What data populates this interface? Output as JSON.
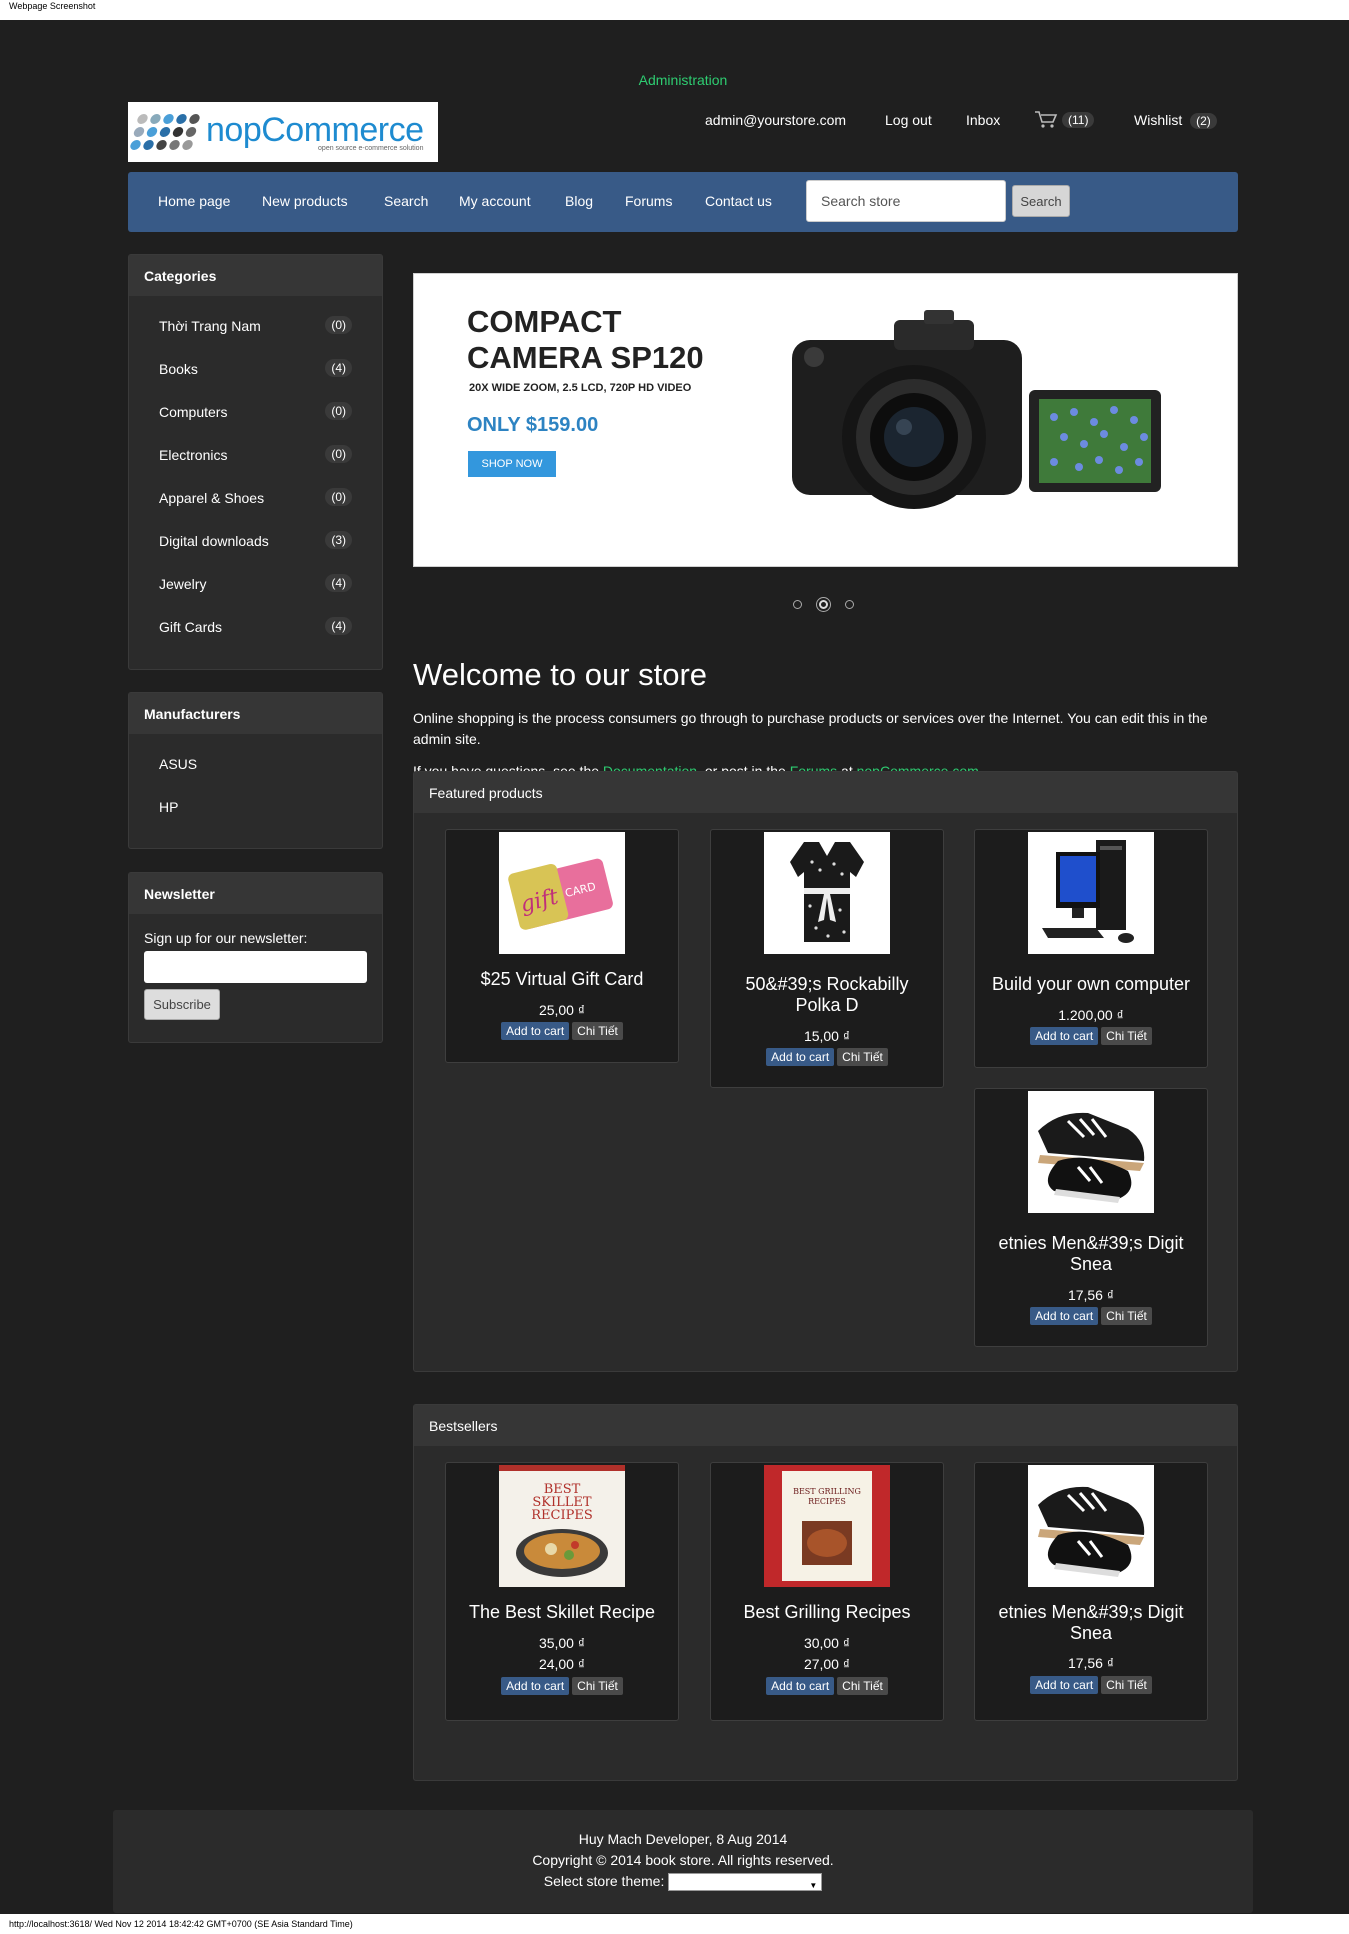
{
  "capture": {
    "title": "Webpage Screenshot",
    "status": "http://localhost:3618/  Wed Nov 12 2014 18:42:42 GMT+0700 (SE Asia Standard Time)"
  },
  "header": {
    "admin_link": "Administration",
    "logo_name": "nopCommerce",
    "logo_tagline": "open source e-commerce solution",
    "email": "admin@yourstore.com",
    "logout": "Log out",
    "inbox": "Inbox",
    "cart_count": "(11)",
    "wishlist": "Wishlist",
    "wishlist_count": "(2)"
  },
  "nav": {
    "items": [
      "Home page",
      "New products",
      "Search",
      "My account",
      "Blog",
      "Forums",
      "Contact us"
    ],
    "search_placeholder": "Search store",
    "search_button": "Search"
  },
  "categories": {
    "title": "Categories",
    "items": [
      {
        "label": "Thời Trang Nam",
        "count": "(0)"
      },
      {
        "label": "Books",
        "count": "(4)"
      },
      {
        "label": "Computers",
        "count": "(0)"
      },
      {
        "label": "Electronics",
        "count": "(0)"
      },
      {
        "label": "Apparel & Shoes",
        "count": "(0)"
      },
      {
        "label": "Digital downloads",
        "count": "(3)"
      },
      {
        "label": "Jewelry",
        "count": "(4)"
      },
      {
        "label": "Gift Cards",
        "count": "(4)"
      }
    ]
  },
  "manufacturers": {
    "title": "Manufacturers",
    "items": [
      "ASUS",
      "HP"
    ]
  },
  "newsletter": {
    "title": "Newsletter",
    "label": "Sign up for our newsletter:",
    "button": "Subscribe"
  },
  "slider": {
    "title_line1": "COMPACT",
    "title_line2": "CAMERA SP120",
    "subtitle": "20X WIDE ZOOM, 2.5 LCD, 720P HD VIDEO",
    "price": "ONLY $159.00",
    "button": "SHOP NOW"
  },
  "welcome": {
    "title": "Welcome to our store",
    "text1": "Online shopping is the process consumers go through to purchase products or services over the Internet. You can edit this in the admin site.",
    "text2_a": "If you have questions, see the ",
    "text2_link1": "Documentation",
    "text2_b": ", or post in the ",
    "text2_link2": "Forums",
    "text2_c": " at ",
    "text2_link3": "nopCommerce.com"
  },
  "featured": {
    "title": "Featured products",
    "products": [
      {
        "name": "$25 Virtual Gift Card",
        "price": "25,00 ₫",
        "cart": "Add to cart",
        "detail": "Chi Tiết"
      },
      {
        "name": "50&#39;s Rockabilly Polka D",
        "price": "15,00 ₫",
        "cart": "Add to cart",
        "detail": "Chi Tiết"
      },
      {
        "name": "Build your own computer",
        "price": "1.200,00 ₫",
        "cart": "Add to cart",
        "detail": "Chi Tiết"
      },
      {
        "name": "etnies Men&#39;s Digit Snea",
        "price": "17,56 ₫",
        "cart": "Add to cart",
        "detail": "Chi Tiết"
      }
    ]
  },
  "bestsellers": {
    "title": "Bestsellers",
    "products": [
      {
        "name": "The Best Skillet Recipe",
        "old_price": "35,00 ₫",
        "price": "24,00 ₫",
        "cart": "Add to cart",
        "detail": "Chi Tiết",
        "cover_title": "BEST SKILLET RECIPES"
      },
      {
        "name": "Best Grilling Recipes",
        "old_price": "30,00 ₫",
        "price": "27,00 ₫",
        "cart": "Add to cart",
        "detail": "Chi Tiết",
        "cover_title": "BEST GRILLING RECIPES"
      },
      {
        "name": "etnies Men&#39;s Digit Snea",
        "price": "17,56 ₫",
        "cart": "Add to cart",
        "detail": "Chi Tiết"
      }
    ]
  },
  "footer": {
    "line1": "Huy Mach Developer, 8 Aug 2014",
    "line2": "Copyright © 2014 book store. All rights reserved.",
    "theme_label": "Select store theme:"
  }
}
